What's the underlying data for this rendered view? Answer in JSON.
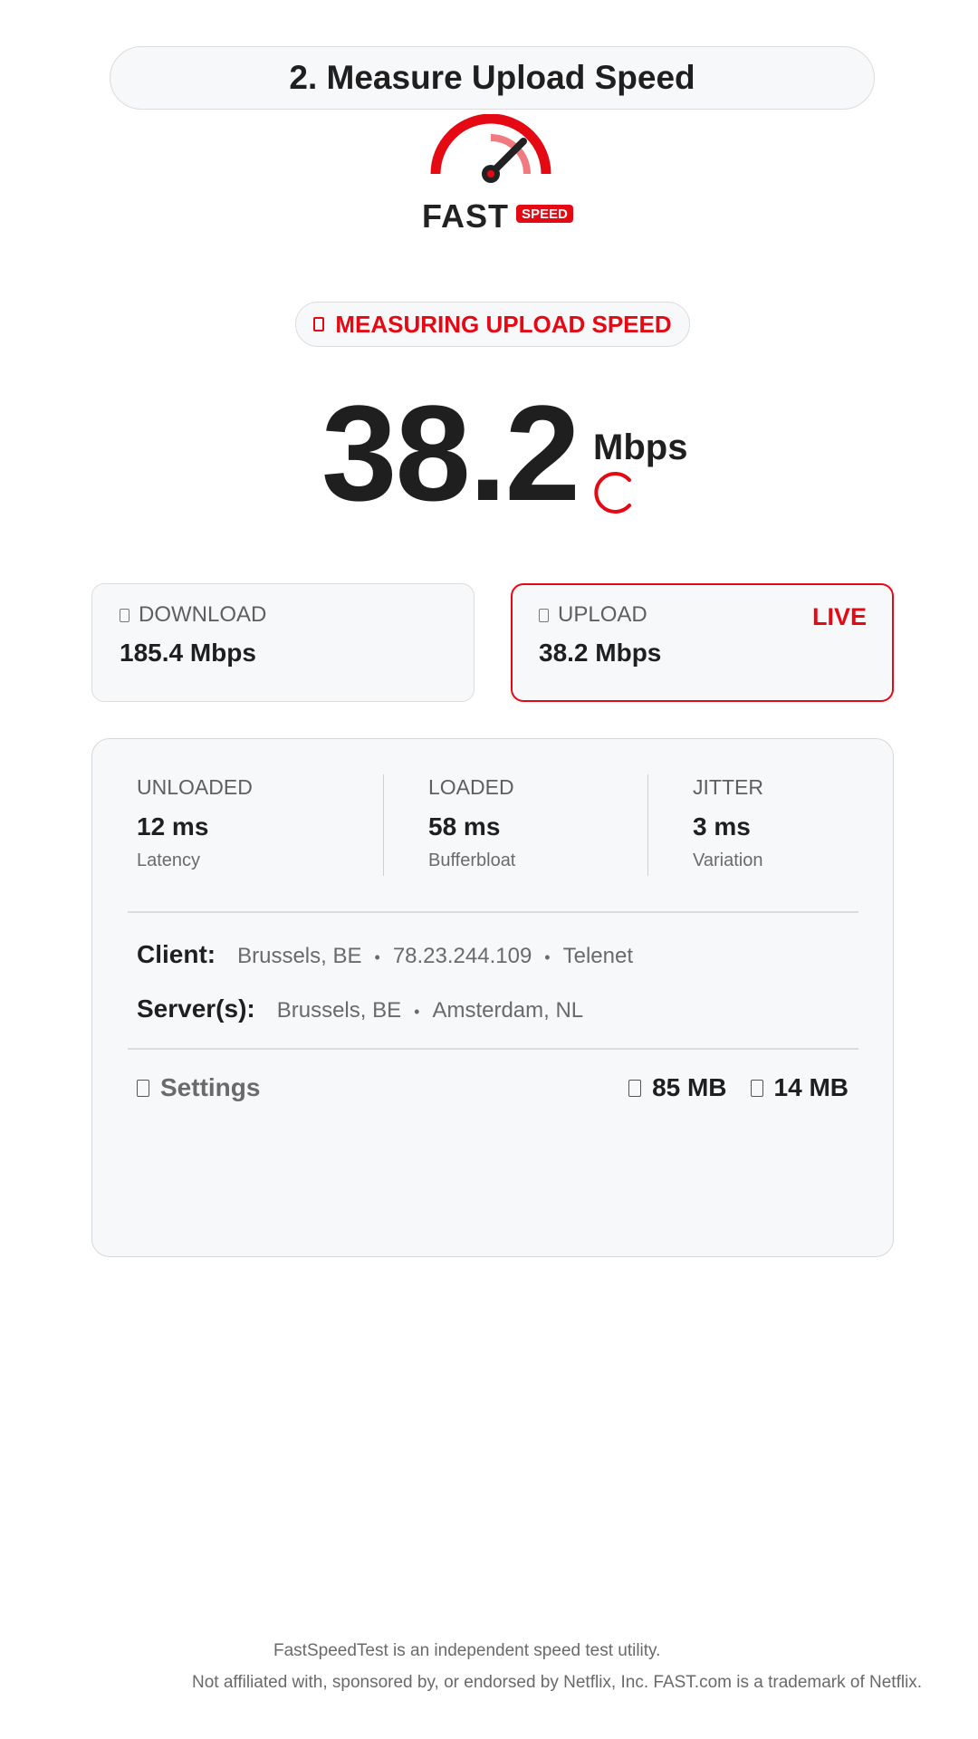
{
  "step_title": "2. Measure Upload Speed",
  "logo": {
    "word": "FAST",
    "badge": "SPEED",
    "accent": "#e50914"
  },
  "status": {
    "icon": "square-icon",
    "text": "MEASURING UPLOAD SPEED"
  },
  "speed": {
    "value": "38.2",
    "unit": "Mbps"
  },
  "download": {
    "icon": "square-icon",
    "label": "DOWNLOAD",
    "value": "185.4 Mbps"
  },
  "upload": {
    "icon": "square-icon",
    "label": "UPLOAD",
    "value": "38.2 Mbps",
    "badge": "LIVE"
  },
  "metrics": [
    {
      "label": "UNLOADED",
      "value": "12 ms",
      "sub": "Latency"
    },
    {
      "label": "LOADED",
      "value": "58 ms",
      "sub": "Bufferbloat"
    },
    {
      "label": "JITTER",
      "value": "3 ms",
      "sub": "Variation"
    }
  ],
  "client": {
    "label": "Client:",
    "location": "Brussels, BE",
    "ip": "78.23.244.109",
    "isp": "Telenet"
  },
  "servers": {
    "label": "Server(s):",
    "first": "Brussels, BE",
    "second": "Amsterdam, NL"
  },
  "separator": "•",
  "settings_label": "Settings",
  "data_usage": {
    "download": "85 MB",
    "upload": "14 MB"
  },
  "footer": {
    "line1": "FastSpeedTest is an independent speed test utility.",
    "line2": "Not affiliated with, sponsored by, or endorsed by Netflix, Inc. FAST.com is a trademark of Netflix."
  }
}
